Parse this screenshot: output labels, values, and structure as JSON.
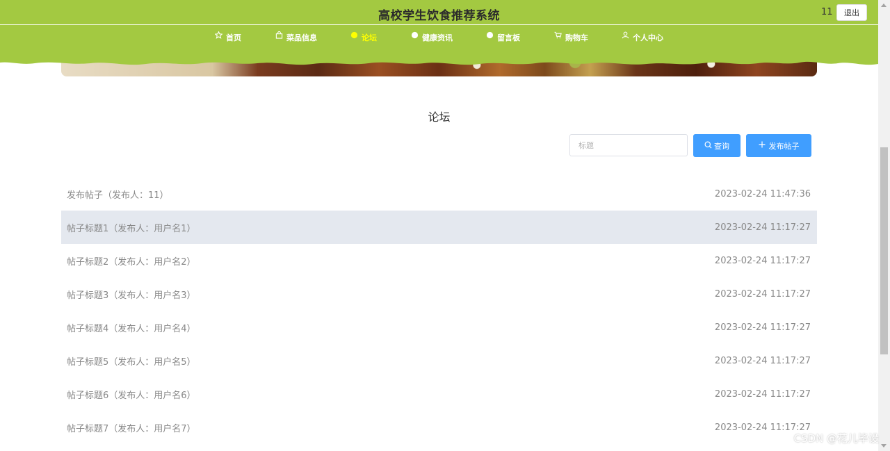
{
  "header": {
    "title": "高校学生饮食推荐系统",
    "username": "11",
    "logout_label": "退出",
    "accent_color": "#a3c941",
    "active_color": "#ffff00"
  },
  "nav": {
    "items": [
      {
        "label": "首页",
        "icon": "star-icon"
      },
      {
        "label": "菜品信息",
        "icon": "bag-icon"
      },
      {
        "label": "论坛",
        "icon": "dot-icon",
        "active": true
      },
      {
        "label": "健康资讯",
        "icon": "dot-icon"
      },
      {
        "label": "留言板",
        "icon": "dot-icon"
      },
      {
        "label": "购物车",
        "icon": "cart-icon"
      },
      {
        "label": "个人中心",
        "icon": "user-icon"
      }
    ]
  },
  "page": {
    "title": "论坛"
  },
  "search": {
    "placeholder": "标题",
    "search_label": "查询",
    "publish_label": "发布帖子",
    "button_color": "#409eff"
  },
  "posts": [
    {
      "title": "发布帖子（发布人：11）",
      "date": "2023-02-24 11:47:36"
    },
    {
      "title": "帖子标题1（发布人：用户名1）",
      "date": "2023-02-24 11:17:27"
    },
    {
      "title": "帖子标题2（发布人：用户名2）",
      "date": "2023-02-24 11:17:27"
    },
    {
      "title": "帖子标题3（发布人：用户名3）",
      "date": "2023-02-24 11:17:27"
    },
    {
      "title": "帖子标题4（发布人：用户名4）",
      "date": "2023-02-24 11:17:27"
    },
    {
      "title": "帖子标题5（发布人：用户名5）",
      "date": "2023-02-24 11:17:27"
    },
    {
      "title": "帖子标题6（发布人：用户名6）",
      "date": "2023-02-24 11:17:27"
    },
    {
      "title": "帖子标题7（发布人：用户名7）",
      "date": "2023-02-24 11:17:27"
    }
  ],
  "watermark": "CSDN @花儿毕设"
}
